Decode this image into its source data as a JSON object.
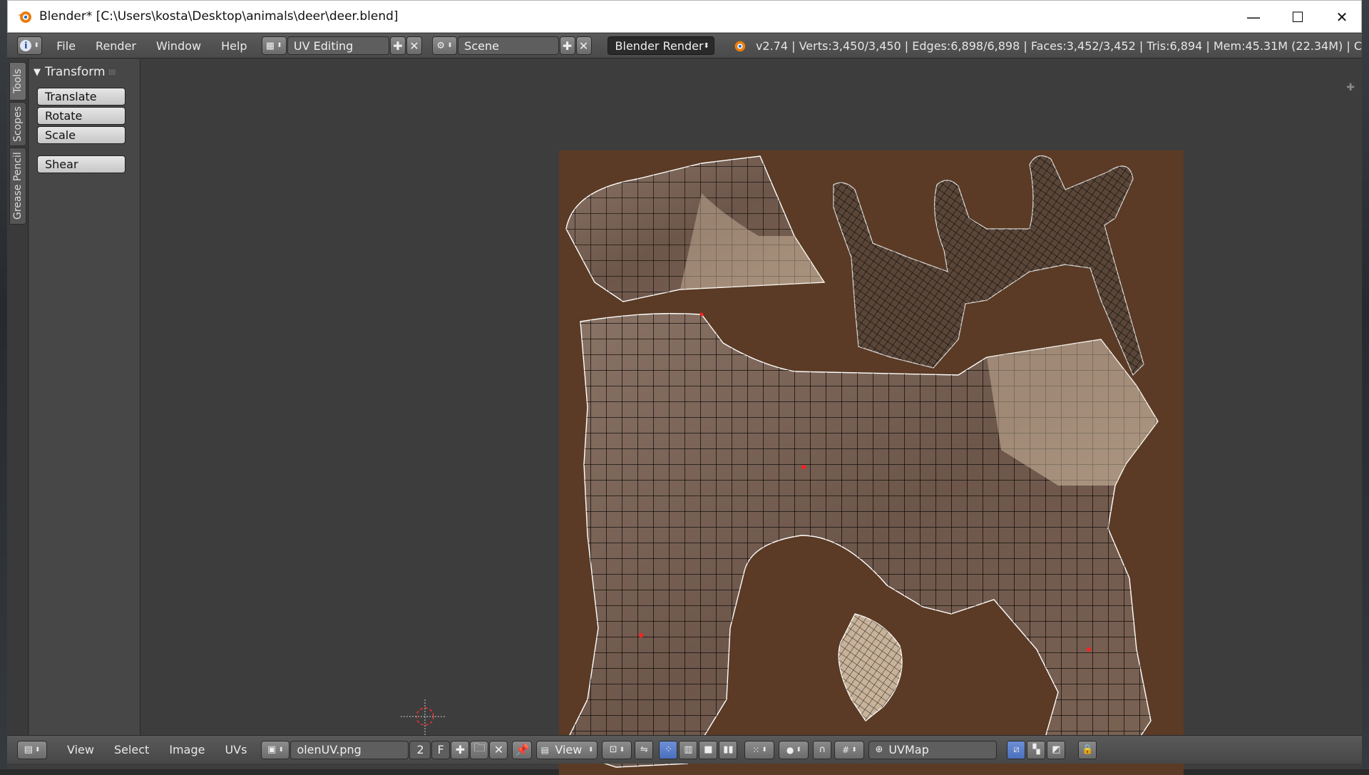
{
  "window": {
    "title": "Blender* [C:\\Users\\kosta\\Desktop\\animals\\deer\\deer.blend]",
    "minimize": "—",
    "maximize": "☐",
    "close": "✕"
  },
  "info_header": {
    "menus": [
      "File",
      "Render",
      "Window",
      "Help"
    ],
    "screen_layout": "UV Editing",
    "scene": "Scene",
    "render_engine": "Blender Render",
    "stats": "v2.74 | Verts:3,450/3,450 | Edges:6,898/6,898 | Faces:3,452/3,452 | Tris:6,894 | Mem:45.31M (22.34M) | C"
  },
  "side_tabs": [
    "Tools",
    "Scopes",
    "Grease Pencil"
  ],
  "tool_panel": {
    "header": "Transform",
    "buttons": [
      "Translate",
      "Rotate",
      "Scale",
      "Shear"
    ]
  },
  "image_editor_header": {
    "menus": [
      "View",
      "Select",
      "Image",
      "UVs"
    ],
    "image_name": "olenUV.png",
    "users": "2",
    "fake_user": "F",
    "view_mode": "View",
    "uv_map": "UVMap"
  },
  "colors": {
    "texture_background": "#5b3b25",
    "selected_vertex": "#ff2020",
    "wire": "#000000"
  }
}
